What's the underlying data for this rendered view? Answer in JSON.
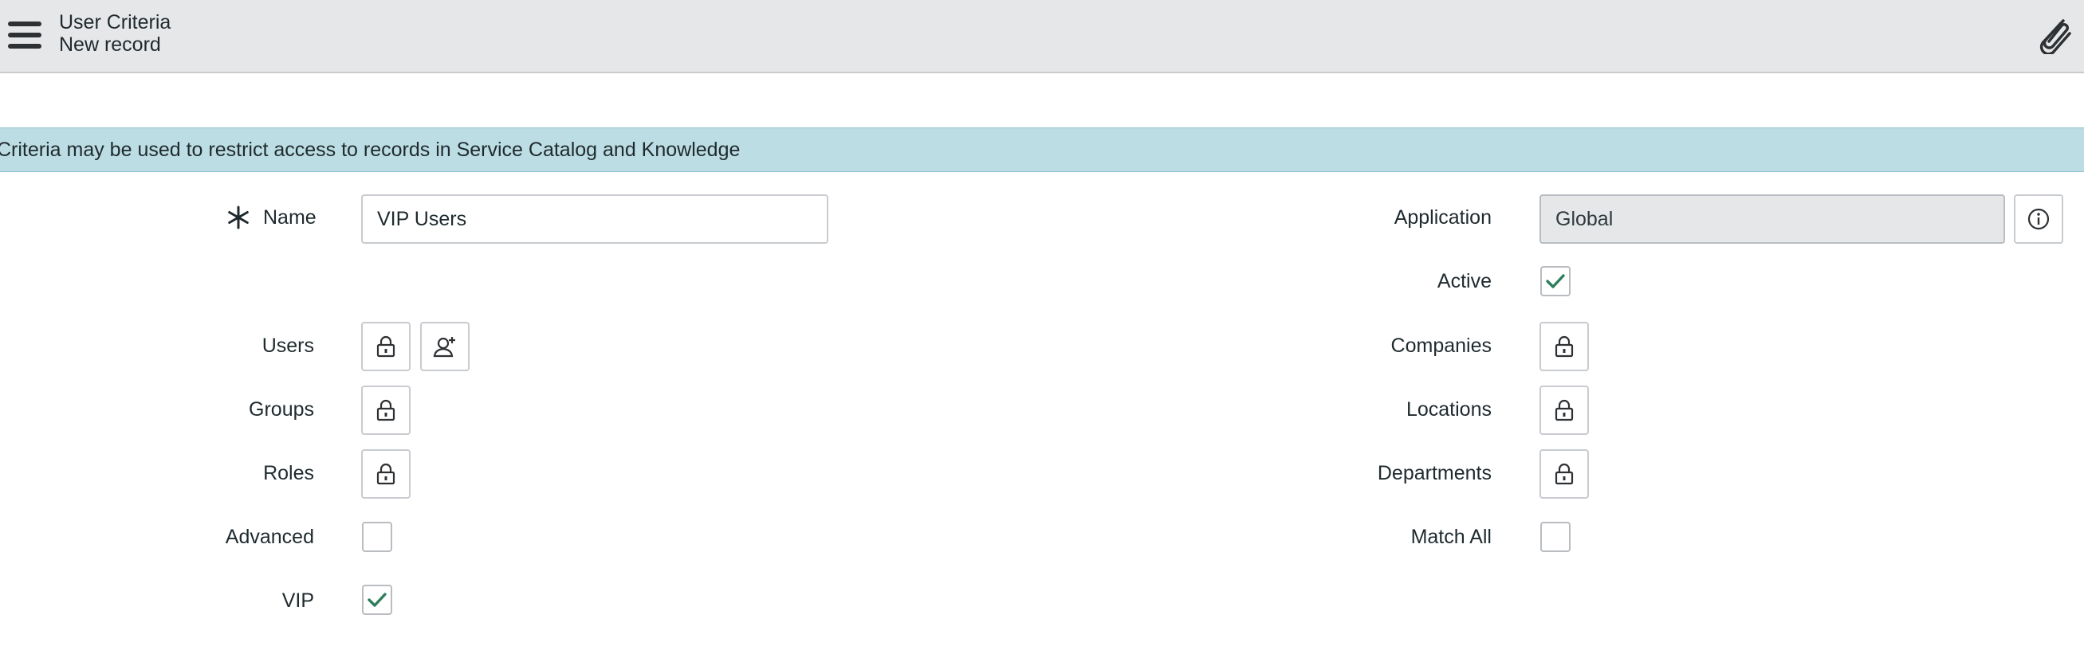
{
  "header": {
    "title": "User Criteria",
    "subtitle": "New record",
    "menu_icon": "hamburger-menu-icon",
    "attach_icon": "paperclip-icon"
  },
  "banner": {
    "text": "Criteria may be used to restrict access to records in Service Catalog and Knowledge"
  },
  "form": {
    "left": {
      "name_label": "Name",
      "name_value": "VIP Users",
      "users_label": "Users",
      "groups_label": "Groups",
      "roles_label": "Roles",
      "advanced_label": "Advanced",
      "advanced_checked": false,
      "vip_label": "VIP",
      "vip_checked": true
    },
    "right": {
      "application_label": "Application",
      "application_value": "Global",
      "active_label": "Active",
      "active_checked": true,
      "companies_label": "Companies",
      "locations_label": "Locations",
      "departments_label": "Departments",
      "match_all_label": "Match All",
      "match_all_checked": false
    }
  },
  "colors": {
    "header_bg": "#e6e7e9",
    "banner_bg": "#bcdde3",
    "checkmark": "#2e7d5b"
  }
}
